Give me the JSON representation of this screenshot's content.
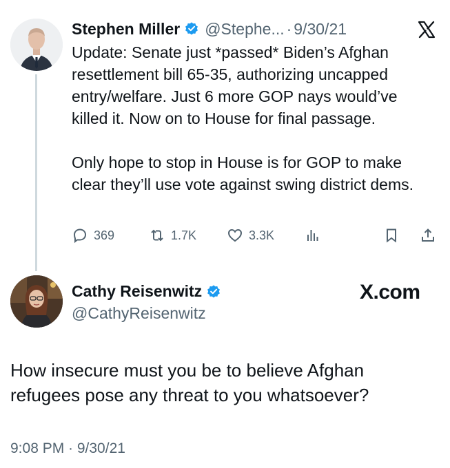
{
  "tweets": [
    {
      "name": "Stephen Miller",
      "handle": "@Stephe...",
      "date": "9/30/21",
      "text_paragraphs": [
        "Update: Senate just *passed* Biden’s Afghan resettlement bill 65-35, authorizing uncapped entry/welfare. Just 6 more GOP nays would’ve killed it. Now on to House for final passage.",
        "Only hope to stop in House is for GOP to make clear they’ll use vote against swing district dems."
      ],
      "stats": {
        "replies": "369",
        "retweets": "1.7K",
        "likes": "3.3K"
      }
    },
    {
      "name": "Cathy Reisenwitz",
      "handle": "@CathyReisenwitz",
      "text": "How insecure must you be to believe Afghan refugees pose any threat to you whatsoever?",
      "timestamp": "9:08 PM · 9/30/21"
    }
  ],
  "brand": {
    "x_logo": "X",
    "x_com": "X.com"
  },
  "separator": "·",
  "colors": {
    "verified": "#1d9bf0",
    "secondary_text": "#536471",
    "primary_text": "#0f1419",
    "thread_line": "#cfd9de"
  },
  "icons": [
    "reply-icon",
    "retweet-icon",
    "like-icon",
    "views-icon",
    "bookmark-icon",
    "share-icon",
    "verified-badge-icon",
    "x-logo-icon"
  ]
}
